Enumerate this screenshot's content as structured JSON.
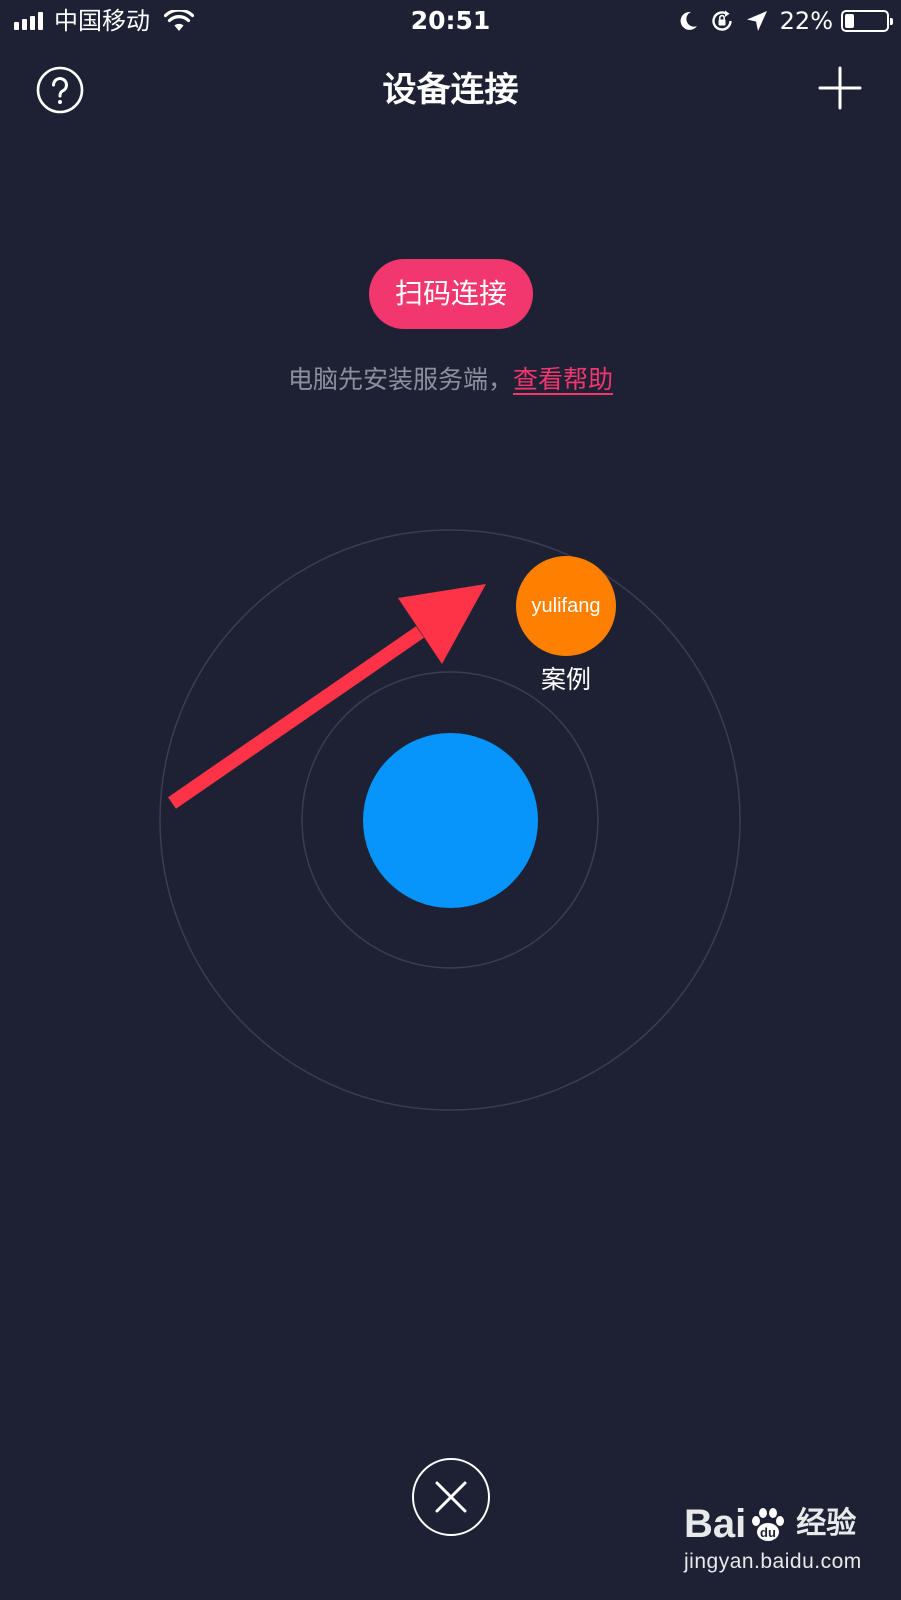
{
  "status_bar": {
    "carrier": "中国移动",
    "time": "20:51",
    "battery_percent_text": "22%",
    "battery_level": 0.22,
    "icons": [
      "signal-icon",
      "wifi-icon",
      "moon-icon",
      "rotation-lock-icon",
      "location-arrow-icon",
      "battery-icon"
    ]
  },
  "nav": {
    "title": "设备连接",
    "left_icon": "help-icon",
    "right_icon": "plus-icon"
  },
  "scan": {
    "button_label": "扫码连接",
    "hint_text": "电脑先安装服务端，",
    "help_link": "查看帮助"
  },
  "radar": {
    "device": {
      "name": "yulifang",
      "label": "案例",
      "color": "#ff7f00"
    },
    "self_color": "#0795fb",
    "ring_color": "#3a3e4f",
    "annotation_arrow_color": "#ff3347"
  },
  "footer": {
    "close_icon": "close-icon"
  },
  "watermark": {
    "logo_left": "Bai",
    "logo_right": "经验",
    "url": "jingyan.baidu.com"
  },
  "colors": {
    "background": "#1d2133",
    "accent": "#f2366e",
    "muted_text": "#8c8f9c"
  }
}
